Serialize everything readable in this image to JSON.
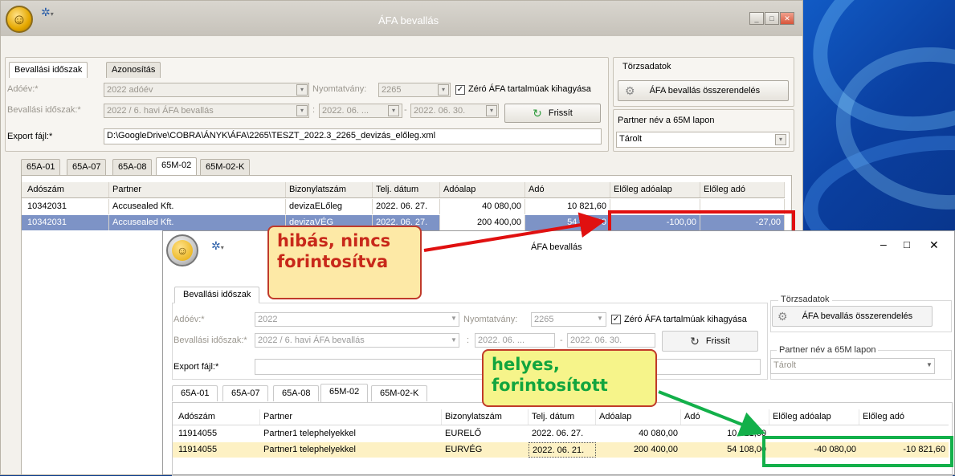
{
  "back_window": {
    "title": "ÁFA bevallás",
    "tabs_top": [
      "Bevallási időszak",
      "Azonosítás"
    ],
    "adoev_label": "Adóév:*",
    "adoev_value": "2022 adóév",
    "nyomtatvany_label": "Nyomtatvány:",
    "nyomtatvany_value": "2265",
    "zero_afa_label": "Zéró ÁFA tartalmúak kihagyása",
    "zero_afa_checked": "✓",
    "idoszak_label": "Bevallási időszak:*",
    "idoszak_value": "2022 / 6. havi ÁFA bevallás",
    "date_from": "2022. 06. ...",
    "date_sep": "-",
    "date_to": "2022. 06. 30.",
    "colon": ":",
    "frissit": "Frissít",
    "export_label": "Export fájl:*",
    "export_value": "D:\\GoogleDrive\\COBRA\\ÁNYK\\ÁFA\\2265\\TESZT_2022.3_2265_devizás_előleg.xml",
    "torzsadatok": "Törzsadatok",
    "osszerendeles": "ÁFA bevallás összerendelés",
    "partner_nev_label": "Partner név a 65M lapon",
    "partner_nev_value": "Tárolt",
    "lap_tabs": [
      "65A-01",
      "65A-07",
      "65A-08",
      "65M-02",
      "65M-02-K"
    ],
    "columns": [
      "Adószám",
      "Partner",
      "Bizonylatszám",
      "Telj. dátum",
      "Adóalap",
      "Adó",
      "Előleg adóalap",
      "Előleg adó"
    ],
    "rows": [
      [
        "10342031",
        "Accusealed Kft.",
        "devizaELőleg",
        "2022. 06. 27.",
        "40 080,00",
        "10 821,60",
        "",
        ""
      ],
      [
        "10342031",
        "Accusealed Kft.",
        "devizaVÉG",
        "2022. 06. 27.",
        "200 400,00",
        "54 108,00",
        "-100,00",
        "-27,00"
      ]
    ]
  },
  "front_window": {
    "title": "ÁFA bevallás",
    "tabs_top": [
      "Bevallási időszak"
    ],
    "adoev_label": "Adóév:*",
    "adoev_value": "2022",
    "nyomtatvany_label": "Nyomtatvány:",
    "nyomtatvany_value": "2265",
    "zero_afa_label": "Zéró ÁFA tartalmúak kihagyása",
    "zero_afa_checked": "✓",
    "idoszak_label": "Bevallási időszak:*",
    "idoszak_value": "2022 / 6. havi ÁFA bevallás",
    "date_from": "2022. 06. ...",
    "date_sep": "-",
    "date_to": "2022. 06. 30.",
    "colon": ":",
    "frissit": "Frissít",
    "export_label": "Export fájl:*",
    "torzsadatok": "Törzsadatok",
    "osszerendeles": "ÁFA bevallás összerendelés",
    "partner_nev_label": "Partner név a 65M lapon",
    "partner_nev_value": "Tárolt",
    "lap_tabs": [
      "65A-01",
      "65A-07",
      "65A-08",
      "65M-02",
      "65M-02-K"
    ],
    "columns": [
      "Adószám",
      "Partner",
      "Bizonylatszám",
      "Telj. dátum",
      "Adóalap",
      "Adó",
      "Előleg adóalap",
      "Előleg adó"
    ],
    "rows": [
      [
        "11914055",
        "Partner1 telephelyekkel",
        "EURELŐ",
        "2022. 06. 27.",
        "40 080,00",
        "10 821,60",
        "",
        ""
      ],
      [
        "11914055",
        "Partner1 telephelyekkel",
        "EURVÉG",
        "2022. 06. 21.",
        "200 400,00",
        "54 108,00",
        "-40 080,00",
        "-10 821,60"
      ]
    ]
  },
  "annotations": {
    "red_callout": [
      "hibás, nincs",
      "forintosítva"
    ],
    "green_callout": [
      "helyes,",
      "forintosított"
    ]
  },
  "colors": {
    "red": "#e01010",
    "green": "#13b04a",
    "red_callout_bg": "#fde9a6",
    "green_callout_bg": "#f6f48a",
    "red_text": "#c8281a",
    "green_text": "#12a53e"
  }
}
